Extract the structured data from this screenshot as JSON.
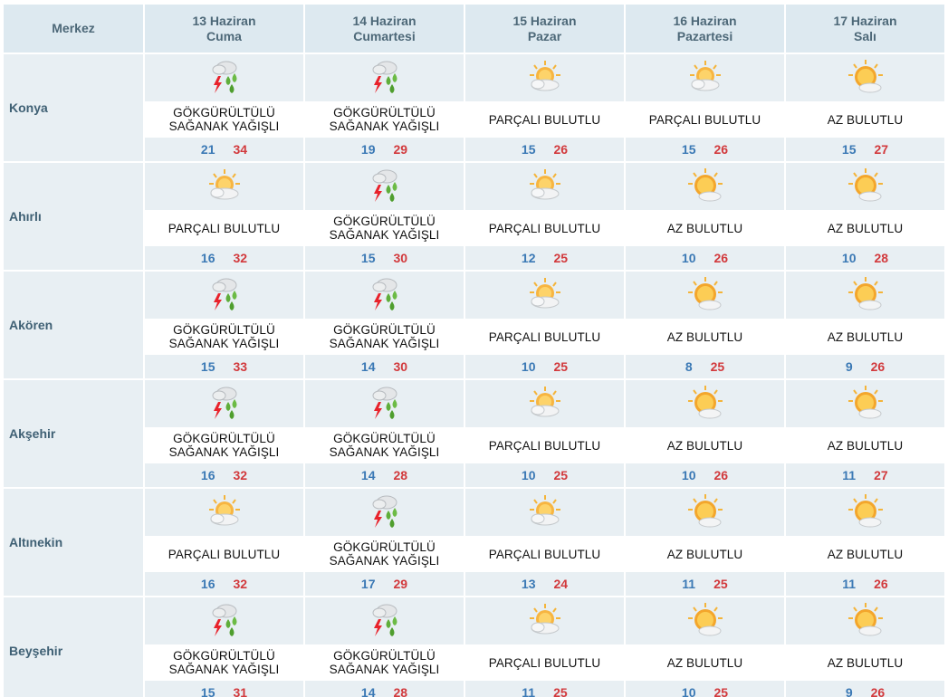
{
  "header": {
    "merkez_label": "Merkez",
    "days": [
      {
        "date": "13 Haziran",
        "weekday": "Cuma"
      },
      {
        "date": "14 Haziran",
        "weekday": "Cumartesi"
      },
      {
        "date": "15 Haziran",
        "weekday": "Pazar"
      },
      {
        "date": "16 Haziran",
        "weekday": "Pazartesi"
      },
      {
        "date": "17 Haziran",
        "weekday": "Salı"
      }
    ]
  },
  "colors": {
    "header_bg": "#dde9f0",
    "row_bg": "#e8eff3",
    "min_temp": "#3b79b5",
    "max_temp": "#d2393c",
    "city_text": "#3f6074"
  },
  "rows": [
    {
      "city": "Konya",
      "days": [
        {
          "icon": "thunderstorm-rain-icon",
          "cond1": "GÖKGÜRÜLTÜLÜ",
          "cond2": "SAĞANAK YAĞIŞLI",
          "min": "21",
          "max": "34"
        },
        {
          "icon": "thunderstorm-rain-icon",
          "cond1": "GÖKGÜRÜLTÜLÜ",
          "cond2": "SAĞANAK YAĞIŞLI",
          "min": "19",
          "max": "29"
        },
        {
          "icon": "partly-cloudy-icon",
          "cond1": "PARÇALI BULUTLU",
          "cond2": "",
          "min": "15",
          "max": "26"
        },
        {
          "icon": "partly-cloudy-icon",
          "cond1": "PARÇALI BULUTLU",
          "cond2": "",
          "min": "15",
          "max": "26"
        },
        {
          "icon": "mostly-sunny-icon",
          "cond1": "AZ BULUTLU",
          "cond2": "",
          "min": "15",
          "max": "27"
        }
      ]
    },
    {
      "city": "Ahırlı",
      "days": [
        {
          "icon": "partly-cloudy-icon",
          "cond1": "PARÇALI BULUTLU",
          "cond2": "",
          "min": "16",
          "max": "32"
        },
        {
          "icon": "thunderstorm-rain-icon",
          "cond1": "GÖKGÜRÜLTÜLÜ",
          "cond2": "SAĞANAK YAĞIŞLI",
          "min": "15",
          "max": "30"
        },
        {
          "icon": "partly-cloudy-icon",
          "cond1": "PARÇALI BULUTLU",
          "cond2": "",
          "min": "12",
          "max": "25"
        },
        {
          "icon": "mostly-sunny-icon",
          "cond1": "AZ BULUTLU",
          "cond2": "",
          "min": "10",
          "max": "26"
        },
        {
          "icon": "mostly-sunny-icon",
          "cond1": "AZ BULUTLU",
          "cond2": "",
          "min": "10",
          "max": "28"
        }
      ]
    },
    {
      "city": "Akören",
      "days": [
        {
          "icon": "thunderstorm-rain-icon",
          "cond1": "GÖKGÜRÜLTÜLÜ",
          "cond2": "SAĞANAK YAĞIŞLI",
          "min": "15",
          "max": "33"
        },
        {
          "icon": "thunderstorm-rain-icon",
          "cond1": "GÖKGÜRÜLTÜLÜ",
          "cond2": "SAĞANAK YAĞIŞLI",
          "min": "14",
          "max": "30"
        },
        {
          "icon": "partly-cloudy-icon",
          "cond1": "PARÇALI BULUTLU",
          "cond2": "",
          "min": "10",
          "max": "25"
        },
        {
          "icon": "mostly-sunny-icon",
          "cond1": "AZ BULUTLU",
          "cond2": "",
          "min": "8",
          "max": "25"
        },
        {
          "icon": "mostly-sunny-icon",
          "cond1": "AZ BULUTLU",
          "cond2": "",
          "min": "9",
          "max": "26"
        }
      ]
    },
    {
      "city": "Akşehir",
      "days": [
        {
          "icon": "thunderstorm-rain-icon",
          "cond1": "GÖKGÜRÜLTÜLÜ",
          "cond2": "SAĞANAK YAĞIŞLI",
          "min": "16",
          "max": "32"
        },
        {
          "icon": "thunderstorm-rain-icon",
          "cond1": "GÖKGÜRÜLTÜLÜ",
          "cond2": "SAĞANAK YAĞIŞLI",
          "min": "14",
          "max": "28"
        },
        {
          "icon": "partly-cloudy-icon",
          "cond1": "PARÇALI BULUTLU",
          "cond2": "",
          "min": "10",
          "max": "25"
        },
        {
          "icon": "mostly-sunny-icon",
          "cond1": "AZ BULUTLU",
          "cond2": "",
          "min": "10",
          "max": "26"
        },
        {
          "icon": "mostly-sunny-icon",
          "cond1": "AZ BULUTLU",
          "cond2": "",
          "min": "11",
          "max": "27"
        }
      ]
    },
    {
      "city": "Altınekin",
      "days": [
        {
          "icon": "partly-cloudy-icon",
          "cond1": "PARÇALI BULUTLU",
          "cond2": "",
          "min": "16",
          "max": "32"
        },
        {
          "icon": "thunderstorm-rain-icon",
          "cond1": "GÖKGÜRÜLTÜLÜ",
          "cond2": "SAĞANAK YAĞIŞLI",
          "min": "17",
          "max": "29"
        },
        {
          "icon": "partly-cloudy-icon",
          "cond1": "PARÇALI BULUTLU",
          "cond2": "",
          "min": "13",
          "max": "24"
        },
        {
          "icon": "mostly-sunny-icon",
          "cond1": "AZ BULUTLU",
          "cond2": "",
          "min": "11",
          "max": "25"
        },
        {
          "icon": "mostly-sunny-icon",
          "cond1": "AZ BULUTLU",
          "cond2": "",
          "min": "11",
          "max": "26"
        }
      ]
    },
    {
      "city": "Beyşehir",
      "days": [
        {
          "icon": "thunderstorm-rain-icon",
          "cond1": "GÖKGÜRÜLTÜLÜ",
          "cond2": "SAĞANAK YAĞIŞLI",
          "min": "15",
          "max": "31"
        },
        {
          "icon": "thunderstorm-rain-icon",
          "cond1": "GÖKGÜRÜLTÜLÜ",
          "cond2": "SAĞANAK YAĞIŞLI",
          "min": "14",
          "max": "28"
        },
        {
          "icon": "partly-cloudy-icon",
          "cond1": "PARÇALI BULUTLU",
          "cond2": "",
          "min": "11",
          "max": "25"
        },
        {
          "icon": "mostly-sunny-icon",
          "cond1": "AZ BULUTLU",
          "cond2": "",
          "min": "10",
          "max": "25"
        },
        {
          "icon": "mostly-sunny-icon",
          "cond1": "AZ BULUTLU",
          "cond2": "",
          "min": "9",
          "max": "26"
        }
      ]
    }
  ]
}
